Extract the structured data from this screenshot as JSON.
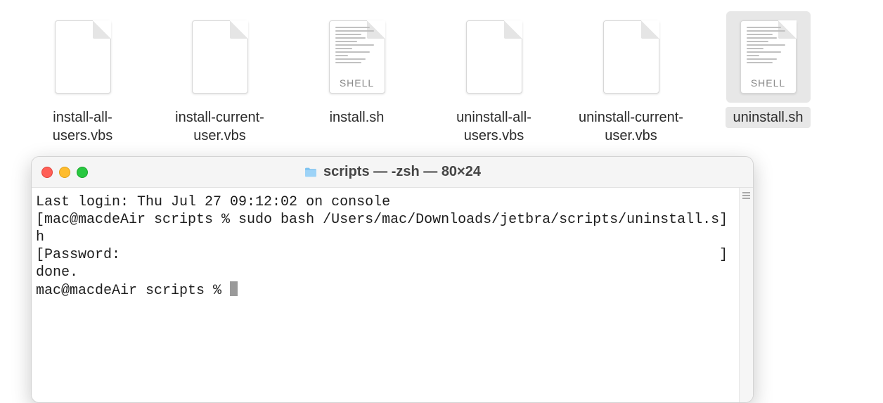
{
  "desktop": {
    "files": [
      {
        "label": "install-all-users.vbs",
        "kind": "plain",
        "selected": false
      },
      {
        "label": "install-current-user.vbs",
        "kind": "plain",
        "selected": false
      },
      {
        "label": "install.sh",
        "kind": "shell",
        "selected": false
      },
      {
        "label": "uninstall-all-users.vbs",
        "kind": "plain",
        "selected": false
      },
      {
        "label": "uninstall-current-user.vbs",
        "kind": "plain",
        "selected": false
      },
      {
        "label": "uninstall.sh",
        "kind": "shell",
        "selected": true
      }
    ],
    "shell_badge": "SHELL"
  },
  "terminal": {
    "title": "scripts — -zsh — 80×24",
    "lines": [
      "Last login: Thu Jul 27 09:12:02 on console",
      "[mac@macdeAir scripts % sudo bash /Users/mac/Downloads/jetbra/scripts/uninstall.s]",
      "h",
      "[Password:                                                                       ]",
      "done.",
      "mac@macdeAir scripts % "
    ]
  }
}
